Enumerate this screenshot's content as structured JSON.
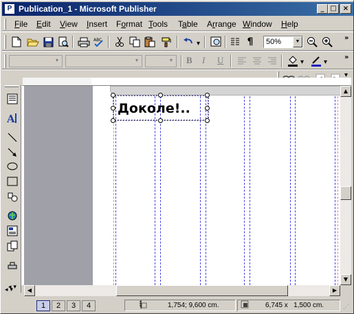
{
  "window": {
    "app_icon": "P",
    "title": "Publication_1 - Microsoft Publisher",
    "minimize": "_",
    "maximize": "□",
    "close": "×"
  },
  "menu": [
    {
      "label": "File",
      "key": "F",
      "rest": "ile"
    },
    {
      "label": "Edit",
      "key": "E",
      "rest": "dit"
    },
    {
      "label": "View",
      "key": "V",
      "rest": "iew"
    },
    {
      "label": "Insert",
      "key": "I",
      "rest": "nsert"
    },
    {
      "label": "Format",
      "key": "o",
      "pre": "F",
      "rest": "rmat"
    },
    {
      "label": "Tools",
      "key": "T",
      "rest": "ools"
    },
    {
      "label": "Table",
      "key": "a",
      "pre": "T",
      "rest": "ble"
    },
    {
      "label": "Arrange",
      "key": "r",
      "pre": "A",
      "rest": "range"
    },
    {
      "label": "Window",
      "key": "W",
      "rest": "indow"
    },
    {
      "label": "Help",
      "key": "H",
      "rest": "elp"
    }
  ],
  "standard_toolbar": {
    "zoom_value": "50%",
    "overflow": "»"
  },
  "formatting_toolbar": {
    "bold": "B",
    "italic": "I",
    "underline": "U",
    "overflow": "»"
  },
  "icons": {
    "new": "new-icon",
    "open": "open-icon",
    "save": "save-icon",
    "preview": "print-preview-icon",
    "print": "print-icon",
    "spelling": "spelling-icon",
    "cut": "cut-icon",
    "copy": "copy-icon",
    "paste": "paste-icon",
    "format_painter": "format-painter-icon",
    "undo": "undo-icon",
    "zoom_out": "zoom-out-icon",
    "zoom_in": "zoom-in-icon"
  },
  "document": {
    "frame_text": "Доколе!.."
  },
  "status": {
    "pages": [
      "1",
      "2",
      "3",
      "4"
    ],
    "active_page": "1",
    "position": "1,754; 9,600 cm.",
    "size": "6,745 x   1,500 cm."
  },
  "colors": {
    "title_start": "#0a246a",
    "title_end": "#3a6ea5",
    "chrome": "#d4d0c8",
    "workspace": "#a0a0a8",
    "guide_blue": "#4040e0",
    "guide_pink": "#e080c0"
  }
}
